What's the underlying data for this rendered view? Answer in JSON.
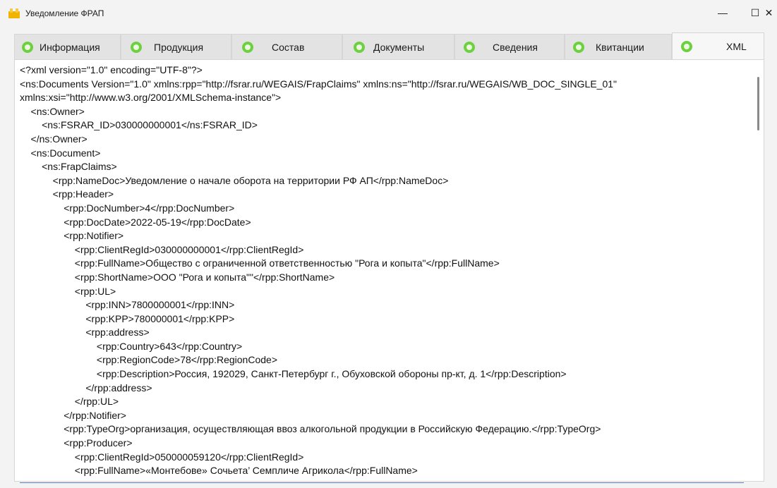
{
  "window": {
    "title": "Уведомление ФРАП",
    "minimize_glyph": "—",
    "maximize_glyph": "☐",
    "close_glyph": "✕"
  },
  "tabs": [
    {
      "label": "Информация",
      "icon": "green-circle-icon",
      "active": false
    },
    {
      "label": "Продукция",
      "icon": "green-circle-icon",
      "active": false
    },
    {
      "label": "Состав",
      "icon": "green-circle-icon",
      "active": false
    },
    {
      "label": "Документы",
      "icon": "green-circle-icon",
      "active": false
    },
    {
      "label": "Сведения",
      "icon": "green-circle-icon",
      "active": false
    },
    {
      "label": "Квитанции",
      "icon": "green-circle-icon",
      "active": false
    },
    {
      "label": "XML",
      "icon": "green-circle-icon",
      "active": true
    }
  ],
  "xml": {
    "lines": [
      "<?xml version=\"1.0\" encoding=\"UTF-8\"?>",
      "<ns:Documents Version=\"1.0\" xmlns:rpp=\"http://fsrar.ru/WEGAIS/FrapClaims\" xmlns:ns=\"http://fsrar.ru/WEGAIS/WB_DOC_SINGLE_01\"",
      "xmlns:xsi=\"http://www.w3.org/2001/XMLSchema-instance\">",
      "    <ns:Owner>",
      "        <ns:FSRAR_ID>030000000001</ns:FSRAR_ID>",
      "    </ns:Owner>",
      "    <ns:Document>",
      "        <ns:FrapClaims>",
      "            <rpp:NameDoc>Уведомление о начале оборота на территории РФ АП</rpp:NameDoc>",
      "            <rpp:Header>",
      "                <rpp:DocNumber>4</rpp:DocNumber>",
      "                <rpp:DocDate>2022-05-19</rpp:DocDate>",
      "                <rpp:Notifier>",
      "                    <rpp:ClientRegId>030000000001</rpp:ClientRegId>",
      "                    <rpp:FullName>Общество с ограниченной ответственностью \"Рога и копыта\"</rpp:FullName>",
      "                    <rpp:ShortName>ООО \"Рога и копыта\"\"</rpp:ShortName>",
      "                    <rpp:UL>",
      "                        <rpp:INN>7800000001</rpp:INN>",
      "                        <rpp:KPP>780000001</rpp:KPP>",
      "                        <rpp:address>",
      "                            <rpp:Country>643</rpp:Country>",
      "                            <rpp:RegionCode>78</rpp:RegionCode>",
      "                            <rpp:Description>Россия, 192029, Санкт-Петербург г., Обуховской обороны пр-кт, д. 1</rpp:Description>",
      "                        </rpp:address>",
      "                    </rpp:UL>",
      "                </rpp:Notifier>",
      "                <rpp:TypeOrg>организация, осуществляющая ввоз алкогольной продукции в Российскую Федерацию.</rpp:TypeOrg>",
      "                <rpp:Producer>",
      "                    <rpp:ClientRegId>050000059120</rpp:ClientRegId>",
      "                    <rpp:FullName>«Монтебове» Сочьета’ Семпличе Агрикола</rpp:FullName>"
    ]
  },
  "colors": {
    "tab_icon": "#6dd13f",
    "accent_focus": "#5a7fbf",
    "app_icon": "#f0b400"
  }
}
